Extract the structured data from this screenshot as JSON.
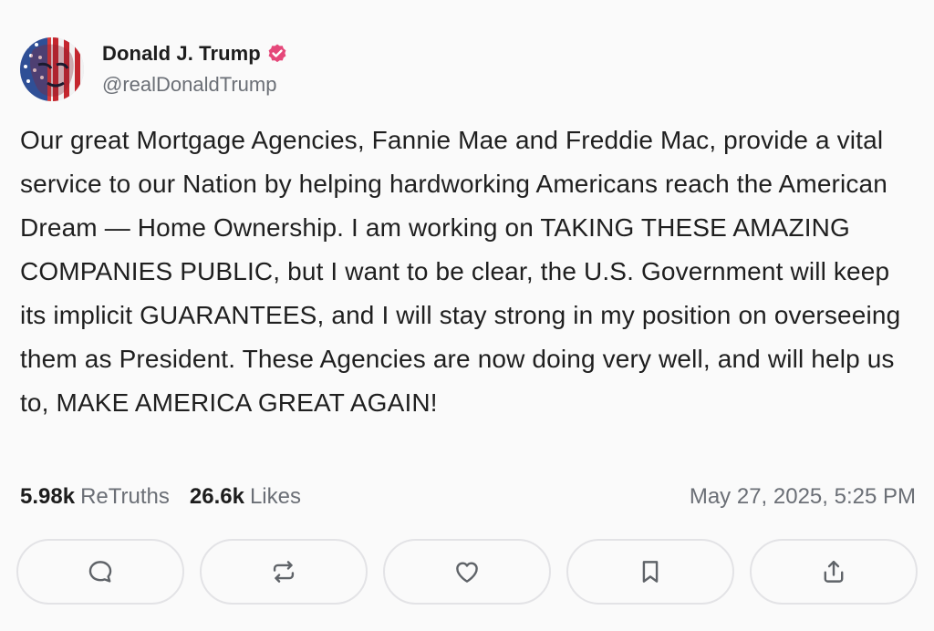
{
  "author": {
    "display_name": "Donald J. Trump",
    "handle": "@realDonaldTrump",
    "verified": true
  },
  "post": {
    "text": "Our great Mortgage Agencies, Fannie Mae and Freddie Mac, provide a vital service to our Nation by helping hardworking Americans reach the American Dream — Home Ownership. I am working on TAKING THESE AMAZING COMPANIES PUBLIC, but I want to be clear, the U.S. Government will keep its implicit GUARANTEES, and I will stay strong in my position on overseeing them as President. These Agencies are now doing very well, and will help us to, MAKE AMERICA GREAT AGAIN!"
  },
  "stats": {
    "retruths_count": "5.98k",
    "retruths_label": "ReTruths",
    "likes_count": "26.6k",
    "likes_label": "Likes",
    "timestamp": "May 27, 2025, 5:25 PM"
  },
  "actions": [
    {
      "icon": "comment-icon"
    },
    {
      "icon": "retruth-icon"
    },
    {
      "icon": "heart-icon"
    },
    {
      "icon": "bookmark-icon"
    },
    {
      "icon": "share-icon"
    }
  ],
  "colors": {
    "background": "#fafafa",
    "text": "#1f1f1f",
    "muted": "#6b6f76",
    "verified_badge": "#e5487a",
    "button_border": "#e3e3e6"
  }
}
